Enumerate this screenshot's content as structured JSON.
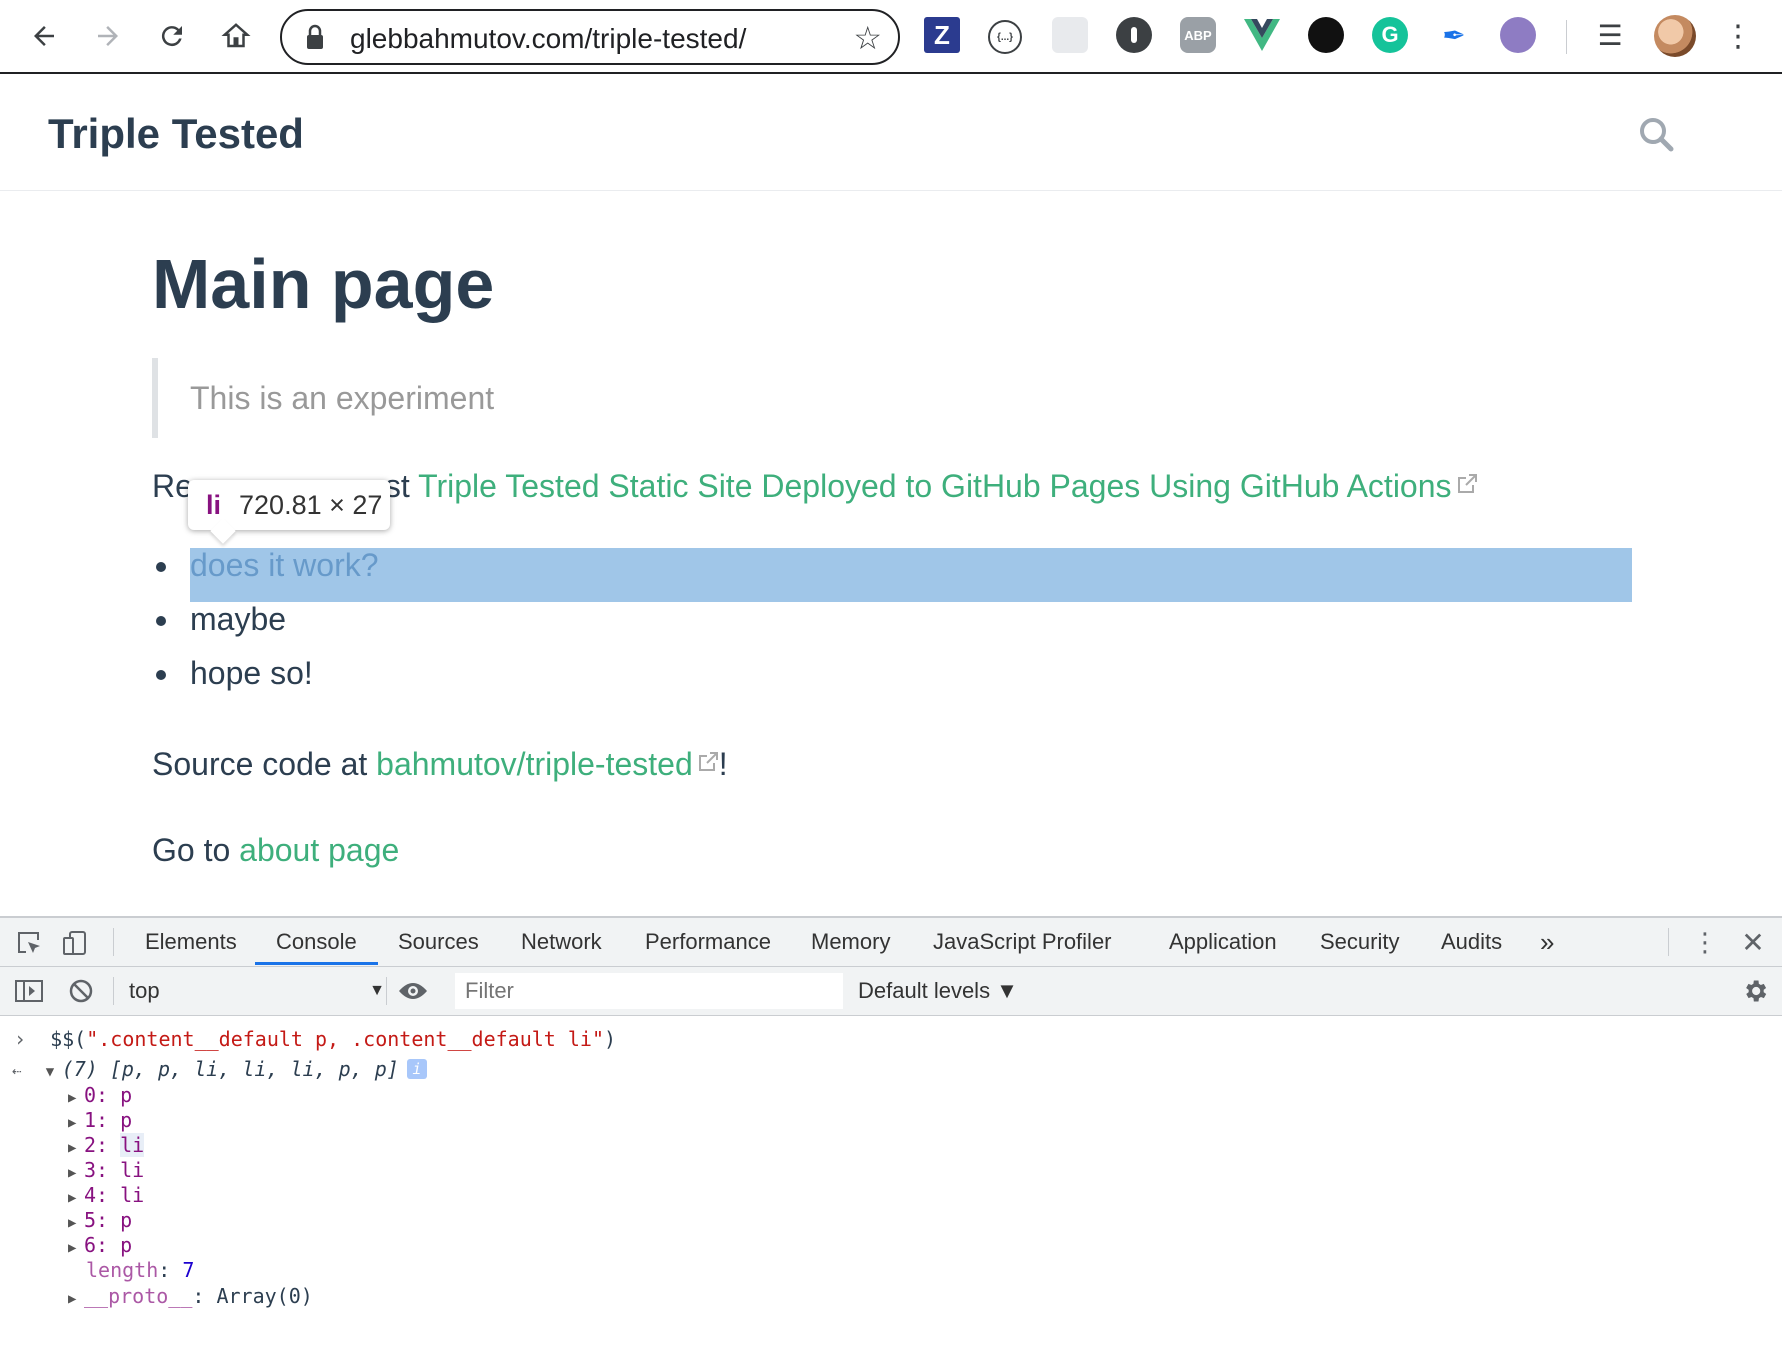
{
  "browser": {
    "url": "glebbahmutov.com/triple-tested/",
    "extensions": [
      "zotero-icon",
      "json-viewer-icon",
      "notes-icon",
      "1password-icon",
      "adblock-plus-icon",
      "vue-devtools-icon",
      "ublock-icon",
      "grammarly-icon",
      "feather-icon",
      "octocat-icon"
    ],
    "ext_labels": {
      "zotero": "Z",
      "json": "{...}",
      "abp": "ABP",
      "grammarly": "G"
    }
  },
  "site": {
    "title": "Triple Tested"
  },
  "page": {
    "heading": "Main page",
    "quote": "This is an experiment",
    "read_prefix": "Read the blog post ",
    "read_prefix_visible_left": "Re",
    "read_prefix_visible_right": "st ",
    "read_link": "Triple Tested Static Site Deployed to GitHub Pages Using GitHub Actions",
    "list": [
      "does it work?",
      "maybe",
      "hope so!"
    ],
    "source_prefix": "Source code at ",
    "source_link": "bahmutov/triple-tested",
    "source_suffix": "!",
    "goto_prefix": "Go to ",
    "goto_link": "about page"
  },
  "inspect_tooltip": {
    "tag": "li",
    "size": "720.81 × 27"
  },
  "devtools": {
    "tabs": [
      "Elements",
      "Console",
      "Sources",
      "Network",
      "Performance",
      "Memory",
      "JavaScript Profiler",
      "Application",
      "Security",
      "Audits"
    ],
    "active_tab": "Console",
    "more_tabs": "»",
    "context": "top",
    "filter_placeholder": "Filter",
    "levels": "Default levels ▼",
    "console": {
      "input_prefix": "$$(",
      "input_string": "\".content__default p, .content__default li\"",
      "input_suffix": ")",
      "result_summary": "(7) [p, p, li, li, li, p, p]",
      "items": [
        {
          "index": "0:",
          "value": "p"
        },
        {
          "index": "1:",
          "value": "p"
        },
        {
          "index": "2:",
          "value": "li"
        },
        {
          "index": "3:",
          "value": "li"
        },
        {
          "index": "4:",
          "value": "li"
        },
        {
          "index": "5:",
          "value": "p"
        },
        {
          "index": "6:",
          "value": "p"
        }
      ],
      "length_label": "length",
      "length_value": "7",
      "proto_label": "__proto__",
      "proto_value": "Array(0)"
    }
  }
}
